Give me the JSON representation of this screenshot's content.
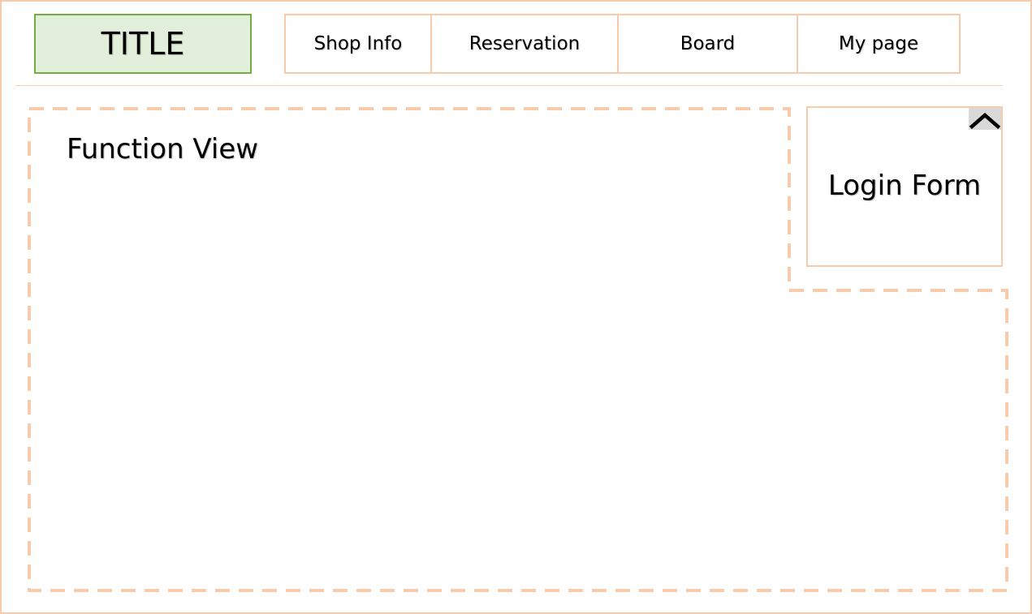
{
  "header": {
    "title": "TITLE",
    "nav_items": [
      {
        "label": "Shop Info"
      },
      {
        "label": "Reservation"
      },
      {
        "label": "Board"
      },
      {
        "label": "My page"
      }
    ]
  },
  "main": {
    "function_view_label": "Function View"
  },
  "login": {
    "label": "Login Form",
    "toggle_icon": "chevron-up-icon"
  },
  "colors": {
    "accent_border": "#f8cbad",
    "title_fill": "#e2efda",
    "title_border": "#70ad47",
    "toggle_fill": "#d9d9d9"
  }
}
